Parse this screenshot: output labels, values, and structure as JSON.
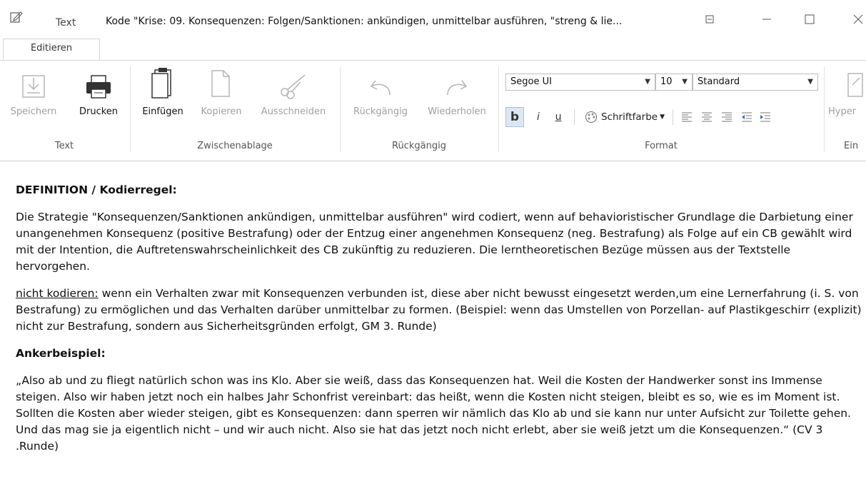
{
  "window": {
    "tab_label": "Text",
    "title": "Kode \"Krise: 09. Konsequenzen: Folgen/Sanktionen: ankündigen, unmittelbar ausführen, \"streng & lie..."
  },
  "ribbon_tab": "Editieren",
  "groups": {
    "text": {
      "label": "Text",
      "save": "Speichern",
      "print": "Drucken"
    },
    "clipboard": {
      "label": "Zwischenablage",
      "paste": "Einfügen",
      "copy": "Kopieren",
      "cut": "Ausschneiden"
    },
    "undo": {
      "label": "Rückgängig",
      "undo": "Rückgängig",
      "redo": "Wiederholen"
    },
    "format": {
      "label": "Format",
      "font": "Segoe UI",
      "size": "10",
      "style": "Standard",
      "bold": "b",
      "italic": "i",
      "underline": "u",
      "font_color": "Schriftfarbe"
    },
    "insert": {
      "label": "Ein",
      "hyperlink": "Hyper"
    }
  },
  "document": {
    "heading1": "DEFINITION / Kodierregel:",
    "para1": "Die Strategie \"Konsequenzen/Sanktionen ankündigen, unmittelbar ausführen\" wird codiert, wenn auf behavioristischer Grundlage die Darbietung einer unangenehmen Konsequenz (positive Bestrafung) oder der Entzug einer angenehmen Konsequenz (neg. Bestrafung) als Folge auf ein CB gewählt wird mit der Intention, die Auftretenswahrscheinlichkeit des CB zukünftig zu reduzieren. Die lerntheoretischen Bezüge müssen aus der Textstelle hervorgehen.",
    "para2_label": "nicht kodieren:",
    "para2_text": " wenn ein Verhalten zwar mit Konsequenzen verbunden ist, diese aber nicht bewusst eingesetzt werden,um eine Lernerfahrung (i. S. von Bestrafung) zu ermöglichen und das Verhalten darüber unmittelbar zu formen. (Beispiel: wenn das Umstellen von Porzellan- auf Plastikgeschirr (explizit) nicht zur Bestrafung, sondern aus Sicherheitsgründen erfolgt, GM 3. Runde)",
    "heading2": "Ankerbeispiel:",
    "para3": "„Also ab und zu fliegt natürlich schon was ins Klo. Aber sie weiß, dass das Konsequenzen hat. Weil die Kosten der Handwerker sonst ins Immense steigen. Also wir haben jetzt noch ein halbes Jahr Schonfrist vereinbart: das heißt, wenn die Kosten nicht steigen, bleibt es so, wie es im Moment ist. Sollten die Kosten aber wieder steigen, gibt es Konsequenzen: dann sperren wir nämlich das Klo ab und sie kann nur unter Aufsicht zur Toilette gehen. Und das mag sie  ja eigentlich nicht – und wir auch nicht. Also sie hat das jetzt noch nicht erlebt, aber sie weiß jetzt um die Konsequenzen.“ (CV 3 .Runde)"
  }
}
